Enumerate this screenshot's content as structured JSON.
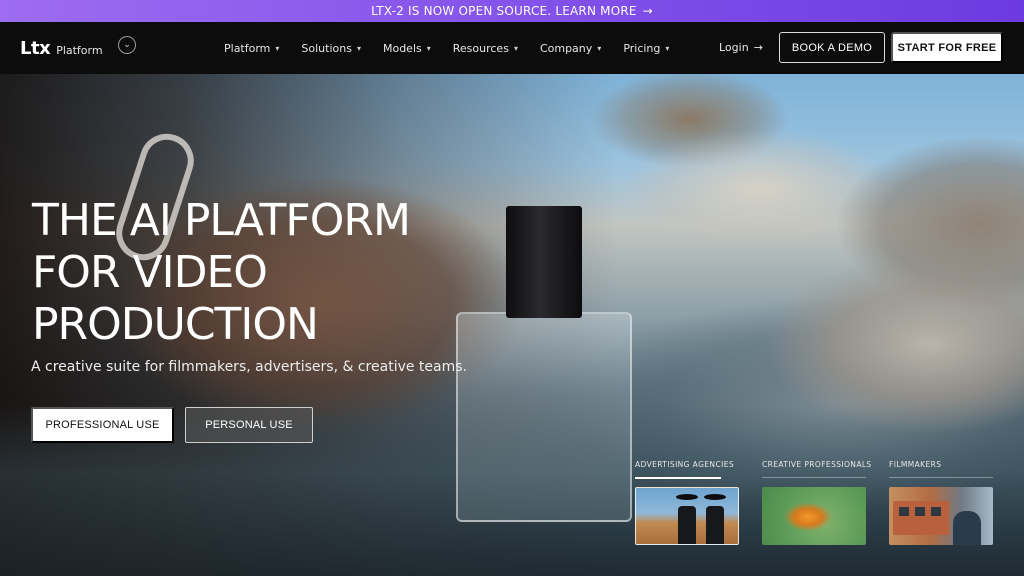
{
  "announcement": {
    "text": "LTX-2 IS NOW OPEN SOURCE. LEARN MORE",
    "arrow": "→"
  },
  "nav": {
    "logo": "Ltx",
    "logo_sub": "Platform",
    "items": [
      {
        "label": "Platform"
      },
      {
        "label": "Solutions"
      },
      {
        "label": "Models"
      },
      {
        "label": "Resources"
      },
      {
        "label": "Company"
      },
      {
        "label": "Pricing"
      }
    ],
    "login": "Login",
    "book_demo": "BOOK A DEMO",
    "start_free": "START FOR FREE"
  },
  "hero": {
    "headline_1": "THE AI PLATFORM",
    "headline_2": "FOR VIDEO",
    "headline_3": "PRODUCTION",
    "subhead": "A creative suite for filmmakers, advertisers, & creative teams.",
    "btn_professional": "PROFESSIONAL USE",
    "btn_personal": "PERSONAL USE"
  },
  "categories": [
    {
      "label": "ADVERTISING AGENCIES",
      "active": true
    },
    {
      "label": "CREATIVE PROFESSIONALS",
      "active": false
    },
    {
      "label": "FILMMAKERS",
      "active": false
    }
  ],
  "colors": {
    "announce": "#8453ea",
    "nav_bg": "#0c0c0d"
  },
  "icons": {
    "chevron": "chevron-down-icon",
    "arrow": "arrow-right-icon"
  }
}
